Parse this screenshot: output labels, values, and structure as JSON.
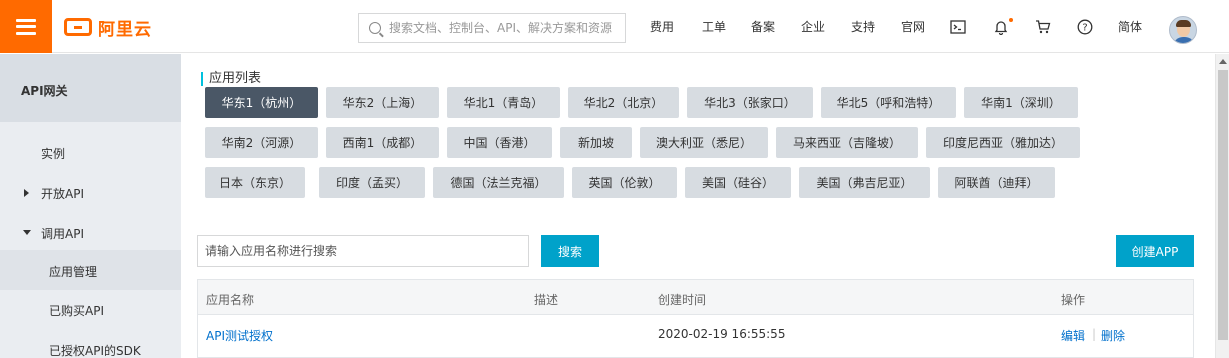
{
  "header": {
    "logo_text": "阿里云",
    "search_placeholder": "搜索文档、控制台、API、解决方案和资源",
    "nav": [
      "费用",
      "工单",
      "备案",
      "企业",
      "支持",
      "官网"
    ],
    "language": "简体",
    "icons": [
      "terminal-icon",
      "bell-icon",
      "cart-icon",
      "help-icon"
    ],
    "accent_color": "#ff6a00"
  },
  "sidebar": {
    "title": "API网关",
    "items": [
      {
        "label": "实例"
      },
      {
        "label": "开放API"
      },
      {
        "label": "调用API"
      },
      {
        "label": "应用管理"
      },
      {
        "label": "已购买API"
      },
      {
        "label": "已授权API的SDK"
      }
    ]
  },
  "main": {
    "section_title": "应用列表",
    "regions": [
      "华东1（杭州）",
      "华东2（上海）",
      "华北1（青岛）",
      "华北2（北京）",
      "华北3（张家口）",
      "华北5（呼和浩特）",
      "华南1（深圳）",
      "华南2（河源）",
      "西南1（成都）",
      "中国（香港）",
      "新加坡",
      "澳大利亚（悉尼）",
      "马来西亚（吉隆坡）",
      "印度尼西亚（雅加达）",
      "日本（东京）",
      "印度（孟买）",
      "德国（法兰克福）",
      "英国（伦敦）",
      "美国（硅谷）",
      "美国（弗吉尼亚）",
      "阿联酋（迪拜）"
    ],
    "active_region": "华东1（杭州）",
    "app_search_placeholder": "请输入应用名称进行搜索",
    "search_button": "搜索",
    "create_button": "创建APP",
    "table": {
      "headers": [
        "应用名称",
        "描述",
        "创建时间",
        "操作"
      ],
      "rows": [
        {
          "name": "API测试授权",
          "description": "",
          "created": "2020-02-19 16:55:55",
          "actions": [
            "编辑",
            "删除"
          ]
        }
      ]
    },
    "button_color": "#00a2ca"
  }
}
